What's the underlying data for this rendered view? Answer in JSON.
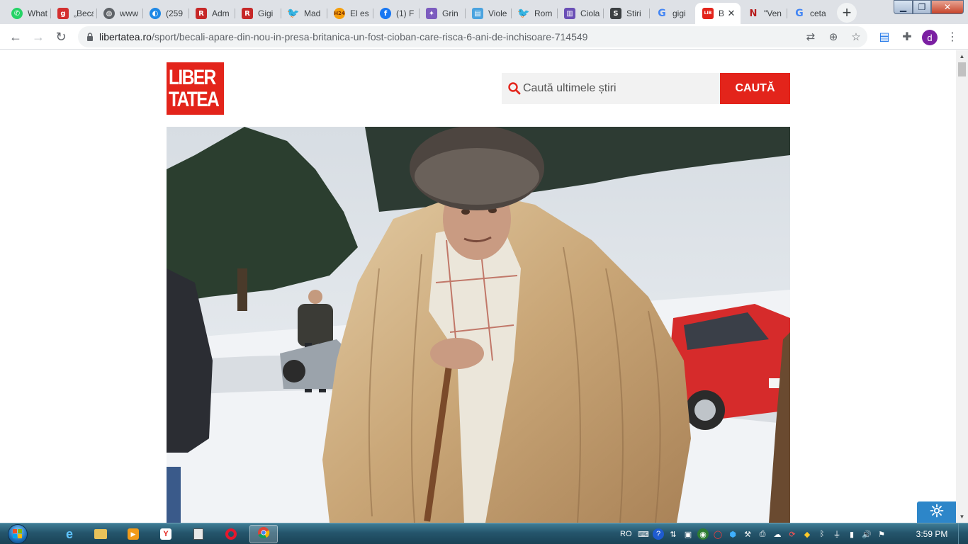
{
  "browser": {
    "tabs": [
      {
        "title": "WhatsApp",
        "icon": "whatsapp-icon",
        "color": "#25d366"
      },
      {
        "title": "„Becali",
        "icon": "g-icon",
        "color": "#d32f2f"
      },
      {
        "title": "www",
        "icon": "globe-icon",
        "color": "#5f6368"
      },
      {
        "title": "(259",
        "icon": "chat-icon",
        "color": "#1e88e5"
      },
      {
        "title": "Adm",
        "icon": "r-icon",
        "color": "#c62828"
      },
      {
        "title": "Gigi",
        "icon": "r-icon",
        "color": "#c62828"
      },
      {
        "title": "Mad",
        "icon": "twitter-icon",
        "color": "#1da1f2"
      },
      {
        "title": "El es",
        "icon": "h24-icon",
        "color": "#f59e0b"
      },
      {
        "title": "(1) F",
        "icon": "facebook-icon",
        "color": "#1877f2"
      },
      {
        "title": "Grin",
        "icon": "crest-icon",
        "color": "#7c5cbf"
      },
      {
        "title": "Viole",
        "icon": "news-icon",
        "color": "#4aa3df"
      },
      {
        "title": "Rom",
        "icon": "twitter-icon",
        "color": "#1da1f2"
      },
      {
        "title": "Ciola",
        "icon": "book-icon",
        "color": "#6a4fb6"
      },
      {
        "title": "Stiri",
        "icon": "s-icon",
        "color": "#3c4043"
      },
      {
        "title": "gigi",
        "icon": "google-icon",
        "color": "#4285f4"
      },
      {
        "title": "B",
        "icon": "libertatea-icon",
        "color": "#e3241b",
        "active": true
      },
      {
        "title": "\"Ven",
        "icon": "n-icon",
        "color": "#b71c1c"
      },
      {
        "title": "ceta",
        "icon": "google-icon",
        "color": "#4285f4"
      }
    ],
    "url_domain": "libertatea.ro",
    "url_path": "/sport/becali-apare-din-nou-in-presa-britanica-un-fost-cioban-care-risca-6-ani-de-inchisoare-714549",
    "profile_letter": "d"
  },
  "site": {
    "logo_line1": "LIBER",
    "logo_line2": "TATEA",
    "search_placeholder": "Caută ultimele știri",
    "search_button": "CAUTĂ",
    "brand_color": "#e3241b"
  },
  "taskbar": {
    "language": "RO",
    "clock": "3:59 PM"
  }
}
